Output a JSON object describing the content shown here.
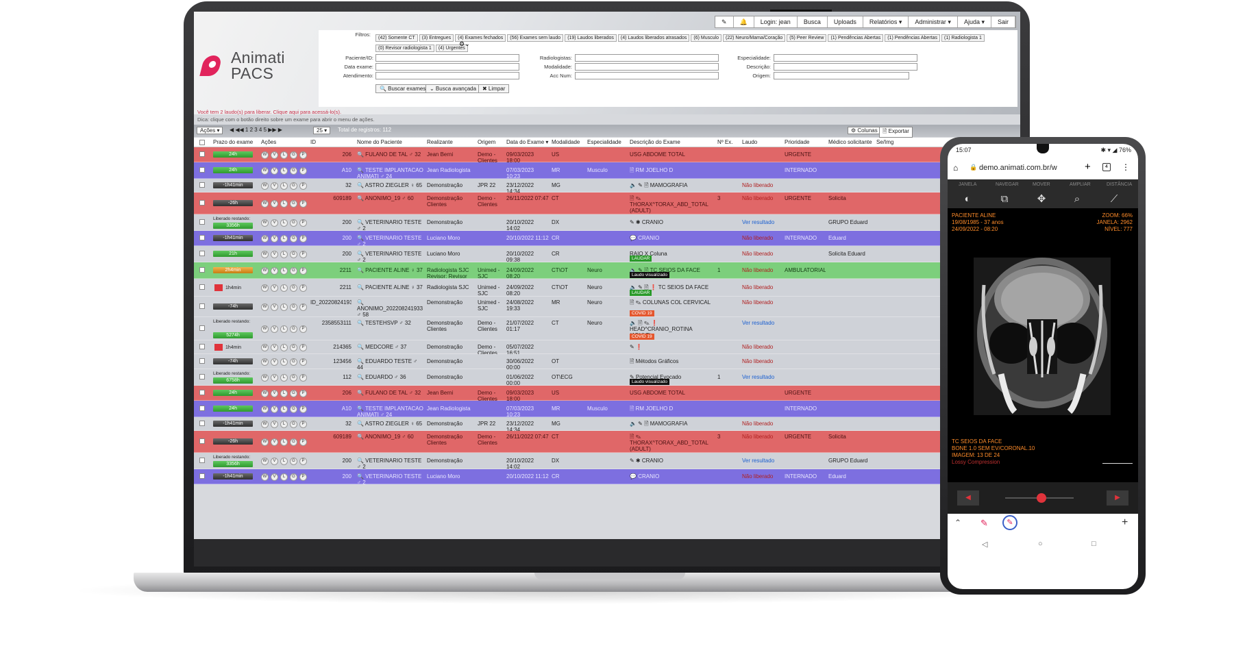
{
  "app": {
    "logo_top": "Animati",
    "logo_bottom": "PACS"
  },
  "topnav": [
    "✎",
    "🔔",
    "Login: jean",
    "Busca",
    "Uploads",
    "Relatórios ▾",
    "Administrar ▾",
    "Ajuda ▾",
    "Sair"
  ],
  "filters": {
    "label": "Filtros:",
    "chips_row1": [
      "(42) Somente CT",
      "(3) Entregues",
      "(4) Exames fechados",
      "(56) Exames sem laudo",
      "(19) Laudos liberados",
      "(4) Laudos liberados atrasados",
      "(6) Musculo",
      "(22) Neuro/Mama/Coração",
      "(5) Peer Review",
      "(1) Pendências Abertas",
      "(1) Pendências Abertas",
      "(1) Radiologista 1"
    ],
    "chips_row2": [
      "(0) Revisor radiologista 1",
      "(4) Urgentes"
    ],
    "col1_labels": [
      "Paciente/ID:",
      "Data exame:",
      "Atendimento:"
    ],
    "col2_labels": [
      "Radiologistas:",
      "Modalidade:",
      "Acc Num:"
    ],
    "col3_labels": [
      "Especialidade:",
      "Descrição:",
      "Origem:"
    ],
    "buttons": {
      "search": "🔍 Buscar exames",
      "advanced": "⌄ Busca avançada",
      "clear": "✖ Limpar"
    }
  },
  "messages": {
    "pending": "Você tem 2 laudo(s) para liberar. Clique aqui para acessá-lo(s).",
    "tip": "Dica: clique com o botão direito sobre um exame para abrir o menu de ações."
  },
  "toolbar": {
    "actions": "Ações ▾",
    "pages": "◀ ◀◀ 1 2 3 4 5 ▶▶ ▶",
    "per_page": "25 ▾",
    "total": "Total de registros: 112",
    "columns": "⚙ Colunas",
    "export": "🗎 Exportar"
  },
  "columns": [
    "",
    "Prazo do exame",
    "Ações",
    "ID",
    "Nome do Paciente",
    "Realizante",
    "Origem",
    "Data do Exame ▾",
    "Modalidade",
    "Especialidade",
    "Descrição do Exame",
    "Nº Ex.",
    "Laudo",
    "Prioridade",
    "Médico solicitante",
    "Se/Img"
  ],
  "rows": [
    {
      "color": "red",
      "h": 22,
      "prazo": "24h",
      "bar": "green",
      "id": "206",
      "name": "🔍 FULANO DE TAL ♂ 32",
      "real": "Jean Berni",
      "orig": "Demo - Clientes",
      "date": "09/03/2023 18:00",
      "mod": "US",
      "esp": "",
      "desc": "USG ABDOME TOTAL",
      "nex": "",
      "laudo": "",
      "prio": "URGENTE",
      "med": ""
    },
    {
      "color": "purple",
      "h": 24,
      "prazo": "24h",
      "bar": "green",
      "id": "A10",
      "name": "🔍 TESTE IMPLANTACAO ANIMATI ♂ 24",
      "real": "Jean Radiologista",
      "orig": "",
      "date": "07/03/2023 10:23",
      "mod": "MR",
      "esp": "Musculo",
      "desc": "🗎 RM JOELHO D",
      "nex": "",
      "laudo": "",
      "prio": "INTERNADO",
      "med": ""
    },
    {
      "color": "grey",
      "h": 20,
      "prazo": "-1h41min",
      "bar": "dark",
      "id": "32",
      "name": "🔍 ASTRO ZIEGLER ♀ 65",
      "real": "Demonstração",
      "orig": "JPR 22",
      "date": "23/12/2022 14:34",
      "mod": "MG",
      "esp": "",
      "desc": "🔈 ✎ 🗎 MAMOGRAFIA",
      "nex": "",
      "laudo": "Não liberado",
      "prio": "",
      "med": ""
    },
    {
      "color": "red",
      "h": 32,
      "prazo": "-26h",
      "bar": "dark",
      "id": "609189",
      "name": "🔍 ANONIMO_19 ♂ 60",
      "real": "Demonstração Clientes",
      "orig": "Demo - Clientes",
      "date": "26/11/2022 07:47",
      "mod": "CT",
      "esp": "",
      "desc": "🗎 ✎ THORAX^TORAX_ABD_TOTAL (ADULT)",
      "nex": "3",
      "laudo": "Não liberado",
      "prio": "URGENTE",
      "med": "Solicita"
    },
    {
      "color": "grey",
      "h": 24,
      "prazo": "3356h",
      "bar": "green",
      "lib": "Liberado restando:",
      "id": "200",
      "name": "🔍 VETERINARIO TESTE ♂ 2",
      "real": "Demonstração",
      "orig": "",
      "date": "20/10/2022 14:02",
      "mod": "DX",
      "esp": "",
      "desc": "✎ ✱ CRANIO",
      "nex": "",
      "laudo": "Ver resultado",
      "prio": "",
      "med": "GRUPO Eduard"
    },
    {
      "color": "purple",
      "h": 22,
      "prazo": "-1h41min",
      "bar": "dark",
      "id": "200",
      "name": "🔍 VETERINARIO TESTE ♂ 2",
      "real": "Luciano Moro",
      "orig": "",
      "date": "20/10/2022 11:12",
      "mod": "CR",
      "esp": "",
      "desc": "💬 CRANIO",
      "nex": "",
      "laudo": "Não liberado",
      "prio": "INTERNADO",
      "med": "Eduard"
    },
    {
      "color": "grey",
      "h": 24,
      "prazo": "21h",
      "bar": "green",
      "id": "200",
      "name": "🔍 VETERINARIO TESTE ♂ 2",
      "real": "Luciano Moro",
      "orig": "",
      "date": "20/10/2022 09:38",
      "mod": "CR",
      "esp": "",
      "desc": "RAIO X Coluna",
      "tag": "LAUDAR",
      "tagc": "laudar",
      "nex": "",
      "laudo": "Não liberado",
      "prio": "",
      "med": "Solicita Eduard"
    },
    {
      "color": "green",
      "h": 24,
      "prazo": "2h4min",
      "bar": "orange",
      "id": "2211",
      "name": "🔍 PACIENTE ALINE ♀ 37",
      "real": "Radiologista SJC Revisor: Revisor Teste",
      "orig": "Unimed - SJC",
      "date": "24/09/2022 08:20",
      "mod": "CT\\OT",
      "esp": "Neuro",
      "desc": "🔈 ✎ 🗎 TC SEIOS DA FACE",
      "tag": "Laudo visualizado",
      "tagc": "vis",
      "nex": "1",
      "laudo": "Não liberado",
      "prio": "AMBULATORIAL",
      "med": ""
    },
    {
      "color": "grey",
      "h": 26,
      "prazo": "1h4min",
      "bar": "red",
      "id": "2211",
      "name": "🔍 PACIENTE ALINE ♀ 37",
      "real": "Radiologista SJC",
      "orig": "Unimed - SJC",
      "date": "24/09/2022 08:20",
      "mod": "CT\\OT",
      "esp": "Neuro",
      "desc": "🔈 ✎ 🗎 ❗ TC SEIOS DA FACE",
      "tag": "LAUDAR",
      "tagc": "laudar",
      "nex": "",
      "laudo": "Não liberado",
      "prio": "",
      "med": ""
    },
    {
      "color": "grey",
      "h": 30,
      "prazo": "-74h",
      "bar": "dark",
      "id": "ID_202208241933",
      "name": "🔍 ANONIMO_202208241933 ♂ 58",
      "real": "Demonstração",
      "orig": "Unimed - SJC",
      "date": "24/08/2022 19:33",
      "mod": "MR",
      "esp": "Neuro",
      "desc": "🗎 ✎ COLUNAS COL CERVICAL",
      "tag": "COVID 19",
      "tagc": "covid",
      "nex": "",
      "laudo": "Não liberado",
      "prio": "",
      "med": ""
    },
    {
      "color": "grey",
      "h": 34,
      "prazo": "5274h",
      "bar": "green",
      "lib": "Liberado restando:",
      "id": "2358553111",
      "name": "🔍 TESTEHSVP ♂ 32",
      "real": "Demonstração Clientes",
      "orig": "Demo - Clientes",
      "date": "21/07/2022 01:17",
      "mod": "CT",
      "esp": "Neuro",
      "desc": "🔈 🗎 ✎ ❗ HEAD^CRANIO_ROTINA (ADULT)",
      "tag": "COVID 19",
      "tagc": "covid",
      "nex": "",
      "laudo": "Ver resultado",
      "prio": "",
      "med": ""
    },
    {
      "color": "grey",
      "h": 20,
      "prazo": "1h4min",
      "bar": "red",
      "id": "214365",
      "name": "🔍 MEDCORE ♂ 37",
      "real": "Demonstração",
      "orig": "Demo - Clientes",
      "date": "05/07/2022 16:51",
      "mod": "",
      "esp": "",
      "desc": "✎ ❗",
      "nex": "",
      "laudo": "Não liberado",
      "prio": "",
      "med": ""
    },
    {
      "color": "grey",
      "h": 22,
      "prazo": "-74h",
      "bar": "dark",
      "id": "123456",
      "name": "🔍 EDUARDO TESTE ♂ 44",
      "real": "Demonstração",
      "orig": "",
      "date": "30/06/2022 00:00",
      "mod": "OT",
      "esp": "",
      "desc": "🗎 Métodos Gráficos",
      "nex": "",
      "laudo": "Não liberado",
      "prio": "",
      "med": ""
    },
    {
      "color": "grey",
      "h": 24,
      "prazo": "6758h",
      "bar": "green",
      "lib": "Liberado restando:",
      "id": "112",
      "name": "🔍 EDUARDO ♂ 36",
      "real": "Demonstração",
      "orig": "",
      "date": "01/06/2022 00:00",
      "mod": "OT\\ECG",
      "esp": "",
      "desc": "✎ Potencial Evocado",
      "tag": "Laudo visualizado",
      "tagc": "vis",
      "nex": "1",
      "laudo": "Ver resultado",
      "prio": "",
      "med": ""
    },
    {
      "color": "red",
      "h": 22,
      "prazo": "24h",
      "bar": "green",
      "id": "206",
      "name": "🔍 FULANO DE TAL ♂ 32",
      "real": "Jean Berni",
      "orig": "Demo - Clientes",
      "date": "09/03/2023 18:00",
      "mod": "US",
      "esp": "",
      "desc": "USG ABDOME TOTAL",
      "nex": "",
      "laudo": "",
      "prio": "URGENTE",
      "med": ""
    },
    {
      "color": "purple",
      "h": 24,
      "prazo": "24h",
      "bar": "green",
      "id": "A10",
      "name": "🔍 TESTE IMPLANTACAO ANIMATI ♂ 24",
      "real": "Jean Radiologista",
      "orig": "",
      "date": "07/03/2023 10:23",
      "mod": "MR",
      "esp": "Musculo",
      "desc": "🗎 RM JOELHO D",
      "nex": "",
      "laudo": "",
      "prio": "INTERNADO",
      "med": ""
    },
    {
      "color": "grey",
      "h": 20,
      "prazo": "-1h41min",
      "bar": "dark",
      "id": "32",
      "name": "🔍 ASTRO ZIEGLER ♀ 65",
      "real": "Demonstração",
      "orig": "JPR 22",
      "date": "23/12/2022 14:34",
      "mod": "MG",
      "esp": "",
      "desc": "🔈 ✎ 🗎 MAMOGRAFIA",
      "nex": "",
      "laudo": "Não liberado",
      "prio": "",
      "med": ""
    },
    {
      "color": "red",
      "h": 32,
      "prazo": "-26h",
      "bar": "dark",
      "id": "609189",
      "name": "🔍 ANONIMO_19 ♂ 60",
      "real": "Demonstração Clientes",
      "orig": "Demo - Clientes",
      "date": "26/11/2022 07:47",
      "mod": "CT",
      "esp": "",
      "desc": "🗎 ✎ THORAX^TORAX_ABD_TOTAL (ADULT)",
      "nex": "3",
      "laudo": "Não liberado",
      "prio": "URGENTE",
      "med": "Solicita"
    },
    {
      "color": "grey",
      "h": 24,
      "prazo": "3356h",
      "bar": "green",
      "lib": "Liberado restando:",
      "id": "200",
      "name": "🔍 VETERINARIO TESTE ♂ 2",
      "real": "Demonstração",
      "orig": "",
      "date": "20/10/2022 14:02",
      "mod": "DX",
      "esp": "",
      "desc": "✎ ✱ CRANIO",
      "nex": "",
      "laudo": "Ver resultado",
      "prio": "",
      "med": "GRUPO Eduard"
    },
    {
      "color": "purple",
      "h": 22,
      "prazo": "-1h41min",
      "bar": "dark",
      "id": "200",
      "name": "🔍 VETERINARIO TESTE ♂ 2",
      "real": "Luciano Moro",
      "orig": "",
      "date": "20/10/2022 11:12",
      "mod": "CR",
      "esp": "",
      "desc": "💬 CRANIO",
      "nex": "",
      "laudo": "Não liberado",
      "prio": "INTERNADO",
      "med": "Eduard"
    }
  ],
  "colors": {
    "red": "#e06768",
    "purple": "#7d6fe0",
    "grey": "#cfd2d8",
    "green": "#7ccf7c",
    "brand": "#e1245c"
  },
  "phone": {
    "time": "15:07",
    "status_icons": "✱ ▾ ◢ 76%",
    "url": "demo.animati.com.br/w",
    "tabs": [
      "JANELA",
      "NAVEGAR",
      "MOVER",
      "AMPLIAR",
      "DISTÂNCIA"
    ],
    "overlay_tl": [
      "PACIENTE ALINE",
      "19/08/1985 - 37 anos",
      "24/09/2022 - 08:20"
    ],
    "overlay_tr": [
      "ZOOM: 66%",
      "JANELA: 2962",
      "NÍVEL: 777"
    ],
    "overlay_bl": [
      "TC SEIOS DA FACE",
      "BONE 1.0 SEM EV/CORONAL.10",
      "IMAGEM: 13 DE 24",
      "Lossy Compression"
    ],
    "tab_count": "4"
  }
}
